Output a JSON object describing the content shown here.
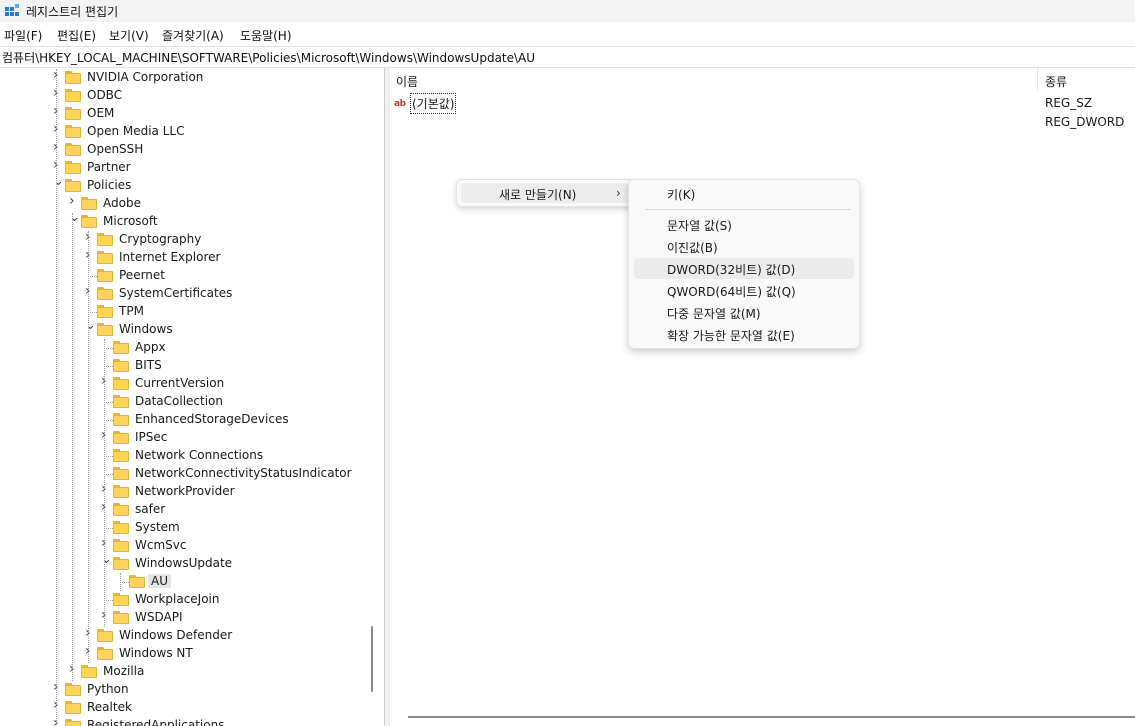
{
  "window": {
    "title": "레지스트리 편집기"
  },
  "menubar": [
    "파일(F)",
    "편집(E)",
    "보기(V)",
    "즐겨찾기(A)",
    "도움말(H)"
  ],
  "address": "컴퓨터\\HKEY_LOCAL_MACHINE\\SOFTWARE\\Policies\\Microsoft\\Windows\\WindowsUpdate\\AU",
  "tree": [
    {
      "label": "NVIDIA Corporation",
      "chevron": "right"
    },
    {
      "label": "ODBC",
      "chevron": "right"
    },
    {
      "label": "OEM",
      "chevron": "right"
    },
    {
      "label": "Open Media LLC",
      "chevron": "right"
    },
    {
      "label": "OpenSSH",
      "chevron": "right"
    },
    {
      "label": "Partner",
      "chevron": "right"
    },
    {
      "label": "Policies",
      "chevron": "down"
    },
    {
      "label": "Adobe",
      "chevron": "right"
    },
    {
      "label": "Microsoft",
      "chevron": "down"
    },
    {
      "label": "Cryptography",
      "chevron": "right"
    },
    {
      "label": "Internet Explorer",
      "chevron": "right"
    },
    {
      "label": "Peernet",
      "chevron": "none"
    },
    {
      "label": "SystemCertificates",
      "chevron": "right"
    },
    {
      "label": "TPM",
      "chevron": "none"
    },
    {
      "label": "Windows",
      "chevron": "down"
    },
    {
      "label": "Appx",
      "chevron": "none"
    },
    {
      "label": "BITS",
      "chevron": "none"
    },
    {
      "label": "CurrentVersion",
      "chevron": "right"
    },
    {
      "label": "DataCollection",
      "chevron": "none"
    },
    {
      "label": "EnhancedStorageDevices",
      "chevron": "none"
    },
    {
      "label": "IPSec",
      "chevron": "right"
    },
    {
      "label": "Network Connections",
      "chevron": "none"
    },
    {
      "label": "NetworkConnectivityStatusIndicator",
      "chevron": "none"
    },
    {
      "label": "NetworkProvider",
      "chevron": "right"
    },
    {
      "label": "safer",
      "chevron": "right"
    },
    {
      "label": "System",
      "chevron": "none"
    },
    {
      "label": "WcmSvc",
      "chevron": "right"
    },
    {
      "label": "WindowsUpdate",
      "chevron": "down"
    },
    {
      "label": "AU",
      "chevron": "none",
      "selected": true
    },
    {
      "label": "WorkplaceJoin",
      "chevron": "none"
    },
    {
      "label": "WSDAPI",
      "chevron": "right"
    },
    {
      "label": "Windows Defender",
      "chevron": "right"
    },
    {
      "label": "Windows NT",
      "chevron": "right"
    },
    {
      "label": "Mozilla",
      "chevron": "right"
    },
    {
      "label": "Python",
      "chevron": "right"
    },
    {
      "label": "Realtek",
      "chevron": "right"
    },
    {
      "label": "RegisteredApplications",
      "chevron": "right"
    }
  ],
  "list": {
    "col_name": "이름",
    "col_type": "종류",
    "rows": [
      {
        "name": "(기본값)",
        "type": "REG_SZ",
        "icon": "string-value-icon"
      },
      {
        "name": "",
        "type": "REG_DWORD"
      }
    ]
  },
  "context_menu": {
    "new_label": "새로 만들기(N)",
    "arrow": "›",
    "submenu": [
      "키(K)",
      "문자열 값(S)",
      "이진값(B)",
      "DWORD(32비트) 값(D)",
      "QWORD(64비트) 값(Q)",
      "다중 문자열 값(M)",
      "확장 가능한 문자열 값(E)"
    ],
    "hover_index": 3
  },
  "colors": {
    "folder": "#ffd35c",
    "folder_border": "#e6b530",
    "selection": "#e5e5e5",
    "menu_bg": "#f9f9f9"
  }
}
